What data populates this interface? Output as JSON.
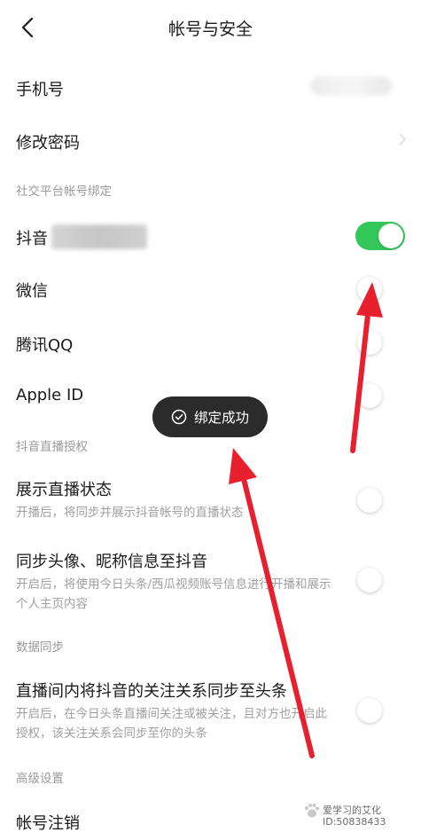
{
  "header": {
    "title": "帐号与安全",
    "back_icon": "chevron-left-icon"
  },
  "rows": {
    "phone": {
      "label": "手机号"
    },
    "password": {
      "label": "修改密码"
    },
    "douyin": {
      "label": "抖音",
      "toggle": "on"
    },
    "wechat": {
      "label": "微信",
      "toggle": "off"
    },
    "qq": {
      "label": "腾讯QQ",
      "toggle": "off"
    },
    "apple": {
      "label": "Apple ID",
      "toggle": "off"
    },
    "live_status": {
      "label": "展示直播状态",
      "desc": "开播后，将同步并展示抖音帐号的直播状态",
      "toggle": "off"
    },
    "sync_avatar": {
      "label": "同步头像、昵称信息至抖音",
      "desc": "开启后，将使用今日头条/西瓜视频账号信息进行开播和展示个人主页内容",
      "toggle": "off"
    },
    "sync_follow": {
      "label": "直播间内将抖音的关注关系同步至头条",
      "desc": "开启后，在今日头条直播间关注或被关注，且对方也开启此授权，该关注关系会同步至你的头条",
      "toggle": "off"
    },
    "cancel": {
      "label": "帐号注销"
    }
  },
  "sections": {
    "social": "社交平台帐号绑定",
    "live_auth": "抖音直播授权",
    "data_sync": "数据同步",
    "advanced": "高级设置"
  },
  "toast": {
    "text": "绑定成功",
    "icon": "check-circle-icon"
  },
  "watermark": {
    "line1": "爱学习的艾化",
    "line2": "ID:50838433"
  },
  "colors": {
    "toggle_on": "#33c759",
    "arrow": "#e8202e",
    "toast_bg": "#2b2b2b"
  }
}
